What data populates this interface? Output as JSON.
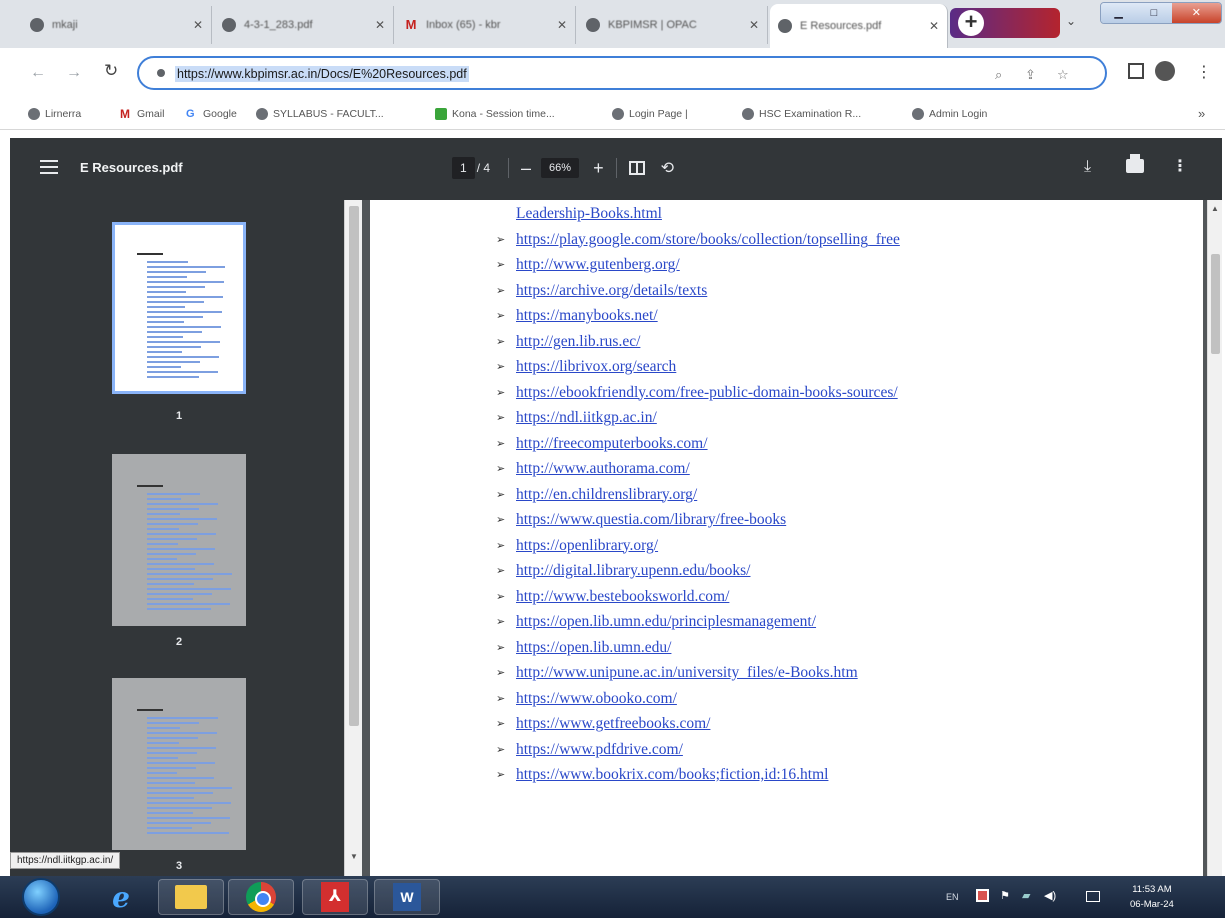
{
  "browser": {
    "tabs": [
      {
        "title": "mkaji",
        "active": false
      },
      {
        "title": "4-3-1_283.pdf",
        "active": false
      },
      {
        "title": "Inbox (65) - kbr",
        "active": false,
        "icon": "gmail-icon"
      },
      {
        "title": "KBPIMSR | OPAC",
        "active": false
      },
      {
        "title": "E Resources.pdf",
        "active": true
      }
    ],
    "address_url": "https://www.kbpimsr.ac.in/Docs/E%20Resources.pdf",
    "bookmarks": [
      {
        "label": "Lirnerra",
        "icon": "globe-icon"
      },
      {
        "label": "Gmail",
        "icon": "gmail-icon"
      },
      {
        "label": "Google",
        "icon": "google-icon"
      },
      {
        "label": "SYLLABUS - FACULT...",
        "icon": "globe-icon"
      },
      {
        "label": "Kona - Session time...",
        "icon": "sheet-icon"
      },
      {
        "label": "Login Page |",
        "icon": "globe-icon"
      },
      {
        "label": "HSC Examination R...",
        "icon": "globe-icon"
      },
      {
        "label": "Admin Login",
        "icon": "globe-icon"
      }
    ]
  },
  "pdf": {
    "title": "E Resources.pdf",
    "page_current": "1",
    "page_total": "/ 4",
    "zoom": "66%",
    "thumbnails": [
      "1",
      "2",
      "3"
    ],
    "selected_page": "1",
    "hover_tooltip": "https://ndl.iitkgp.ac.in/",
    "continued_line": "Leadership-Books.html",
    "links": [
      "https://play.google.com/store/books/collection/topselling_free",
      "http://www.gutenberg.org/",
      "https://archive.org/details/texts",
      "https://manybooks.net/",
      "http://gen.lib.rus.ec/",
      "https://librivox.org/search",
      "https://ebookfriendly.com/free-public-domain-books-sources/",
      "https://ndl.iitkgp.ac.in/",
      "http://freecomputerbooks.com/",
      "http://www.authorama.com/",
      "http://en.childrenslibrary.org/",
      "https://www.questia.com/library/free-books",
      "https://openlibrary.org/",
      "http://digital.library.upenn.edu/books/",
      "http://www.bestebooksworld.com/",
      "https://open.lib.umn.edu/principlesmanagement/",
      "https://open.lib.umn.edu/",
      "http://www.unipune.ac.in/university_files/e-Books.htm",
      "https://www.obooko.com/",
      "https://www.getfreebooks.com/",
      "https://www.pdfdrive.com/",
      "https://www.bookrix.com/books;fiction,id:16.html"
    ]
  },
  "taskbar": {
    "language": "EN",
    "time": "11:53 AM",
    "date": "06-Mar-24"
  },
  "colors": {
    "link": "#2a48c8",
    "pdf_toolbar": "#323639",
    "viewer_bg": "#525659",
    "omnibox_border": "#3f7fd8"
  }
}
